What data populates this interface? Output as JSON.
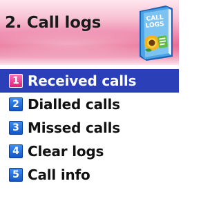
{
  "header": {
    "title": "2. Call logs",
    "icon_name": "call-logs-book-icon",
    "icon_text": "CALL LOGS"
  },
  "menu": {
    "selected_index": 0,
    "items": [
      {
        "number": "1",
        "label": "Received calls"
      },
      {
        "number": "2",
        "label": "Dialled calls"
      },
      {
        "number": "3",
        "label": "Missed calls"
      },
      {
        "number": "4",
        "label": "Clear logs"
      },
      {
        "number": "5",
        "label": "Call info"
      }
    ]
  },
  "colors": {
    "selection": "#2b3fb8",
    "number_badge": "#1e6ad8",
    "number_badge_selected": "#e63a8e",
    "header_pink": "#e7648e"
  }
}
